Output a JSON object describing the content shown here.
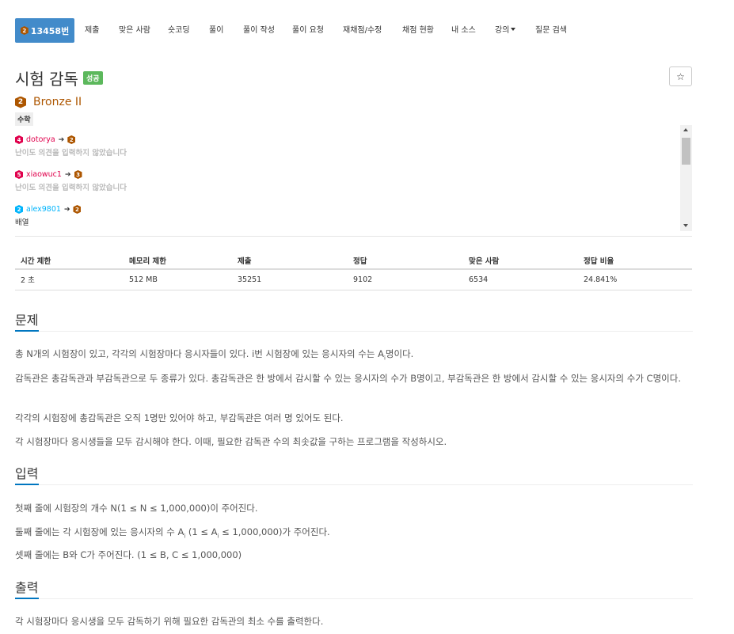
{
  "nav": {
    "active_tier": "2",
    "active_label": "13458번",
    "items": [
      {
        "label": "제출"
      },
      {
        "label": "맞은 사람"
      },
      {
        "label": "숏코딩"
      },
      {
        "label": "풀이"
      },
      {
        "label": "풀이 작성"
      },
      {
        "label": "풀이 요청"
      },
      {
        "label": "재채점/수정"
      },
      {
        "label": "채점 현황"
      },
      {
        "label": "내 소스"
      },
      {
        "label": "강의"
      },
      {
        "label": "질문 검색"
      }
    ]
  },
  "problem": {
    "title": "시험 감독",
    "status": "성공",
    "tier_num": "2",
    "tier_name": "Bronze II",
    "tag": "수학"
  },
  "opinions": [
    {
      "tier_from": "4",
      "user": "dotorya",
      "tier_to": "2",
      "text": "난이도 의견을 입력하지 않았습니다",
      "muted": true
    },
    {
      "tier_from": "5",
      "user": "xiaowuc1",
      "tier_to": "3",
      "text": "난이도 의견을 입력하지 않았습니다",
      "muted": true
    },
    {
      "tier_from": "2",
      "user": "alex9801",
      "tier_to": "2",
      "text": "배열",
      "muted": false
    }
  ],
  "stats": {
    "headers": [
      "시간 제한",
      "메모리 제한",
      "제출",
      "정답",
      "맞은 사람",
      "정답 비율"
    ],
    "values": [
      "2 초",
      "512 MB",
      "35251",
      "9102",
      "6534",
      "24.841%"
    ]
  },
  "sections": {
    "problem_title": "문제",
    "problem_p1a": "총 N개의 시험장이 있고, 각각의 시험장마다 응시자들이 있다. i번 시험장에 있는 응시자의 수는 A",
    "problem_p1_sub": "i",
    "problem_p1b": "명이다.",
    "problem_p2": "감독관은 총감독관과 부감독관으로 두 종류가 있다. 총감독관은 한 방에서 감시할 수 있는 응시자의 수가 B명이고, 부감독관은 한 방에서 감시할 수 있는 응시자의 수가 C명이다.",
    "problem_p3": "각각의 시험장에 총감독관은 오직 1명만 있어야 하고, 부감독관은 여러 명 있어도 된다.",
    "problem_p4": "각 시험장마다 응시생들을 모두 감시해야 한다. 이때, 필요한 감독관 수의 최솟값을 구하는 프로그램을 작성하시오.",
    "input_title": "입력",
    "input_p1": "첫째 줄에 시험장의 개수 N(1 ≤ N ≤ 1,000,000)이 주어진다.",
    "input_p2a": "둘째 줄에는 각 시험장에 있는 응시자의 수 A",
    "input_p2_sub": "i",
    "input_p2b": " (1 ≤ A",
    "input_p2c": " ≤ 1,000,000)가 주어진다.",
    "input_p3": "셋째 줄에는 B와 C가 주어진다. (1 ≤ B, C ≤ 1,000,000)",
    "output_title": "출력",
    "output_p1": "각 시험장마다 응시생을 모두 감독하기 위해 필요한 감독관의 최소 수를 출력한다."
  }
}
